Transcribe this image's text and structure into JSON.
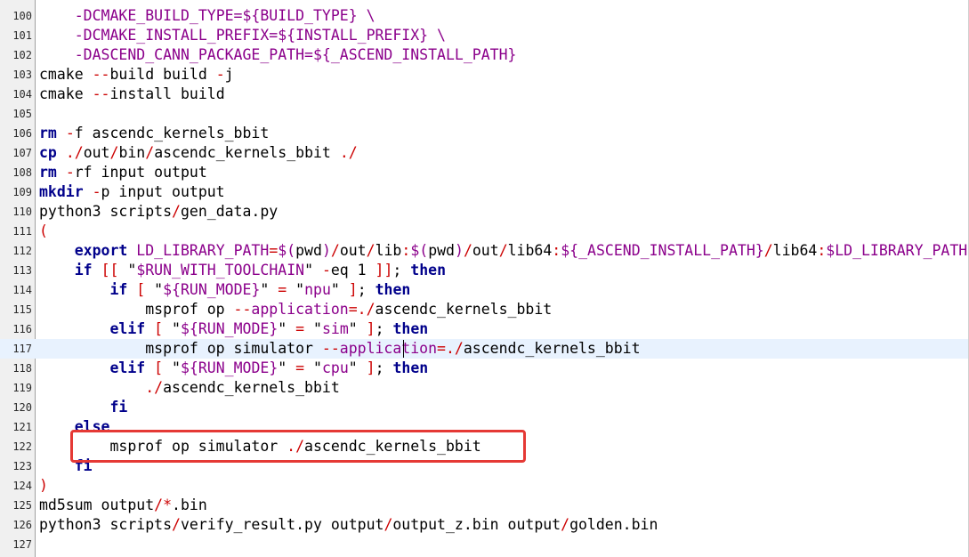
{
  "editor": {
    "lines": [
      {
        "n": "100",
        "segs": [
          [
            "    ",
            "plain"
          ],
          [
            "-DCMAKE_BUILD_TYPE=${BUILD_TYPE} \\",
            "var"
          ]
        ]
      },
      {
        "n": "101",
        "segs": [
          [
            "    ",
            "plain"
          ],
          [
            "-DCMAKE_INSTALL_PREFIX=${INSTALL_PREFIX} \\",
            "var"
          ]
        ]
      },
      {
        "n": "102",
        "segs": [
          [
            "    ",
            "plain"
          ],
          [
            "-DASCEND_CANN_PACKAGE_PATH=${_ASCEND_INSTALL_PATH}",
            "var"
          ]
        ]
      },
      {
        "n": "103",
        "segs": [
          [
            "cmake ",
            "plain"
          ],
          [
            "--",
            "op"
          ],
          [
            "build build ",
            "plain"
          ],
          [
            "-",
            "op"
          ],
          [
            "j",
            "plain"
          ]
        ]
      },
      {
        "n": "104",
        "segs": [
          [
            "cmake ",
            "plain"
          ],
          [
            "--",
            "op"
          ],
          [
            "install build",
            "plain"
          ]
        ]
      },
      {
        "n": "105",
        "segs": []
      },
      {
        "n": "106",
        "segs": [
          [
            "rm",
            "kw"
          ],
          [
            " ",
            "plain"
          ],
          [
            "-",
            "op"
          ],
          [
            "f ascendc_kernels_bbit",
            "plain"
          ]
        ]
      },
      {
        "n": "107",
        "segs": [
          [
            "cp",
            "kw"
          ],
          [
            " ",
            "plain"
          ],
          [
            "./",
            "op"
          ],
          [
            "out",
            "plain"
          ],
          [
            "/",
            "op"
          ],
          [
            "bin",
            "plain"
          ],
          [
            "/",
            "op"
          ],
          [
            "ascendc_kernels_bbit ",
            "plain"
          ],
          [
            "./",
            "op"
          ]
        ]
      },
      {
        "n": "108",
        "segs": [
          [
            "rm",
            "kw"
          ],
          [
            " ",
            "plain"
          ],
          [
            "-",
            "op"
          ],
          [
            "rf input output",
            "plain"
          ]
        ]
      },
      {
        "n": "109",
        "segs": [
          [
            "mkdir",
            "kw"
          ],
          [
            " ",
            "plain"
          ],
          [
            "-",
            "op"
          ],
          [
            "p input output",
            "plain"
          ]
        ]
      },
      {
        "n": "110",
        "segs": [
          [
            "python3 scripts",
            "plain"
          ],
          [
            "/",
            "op"
          ],
          [
            "gen_data.py",
            "plain"
          ]
        ]
      },
      {
        "n": "111",
        "segs": [
          [
            "(",
            "op"
          ]
        ]
      },
      {
        "n": "112",
        "segs": [
          [
            "    ",
            "plain"
          ],
          [
            "export",
            "kw"
          ],
          [
            " ",
            "plain"
          ],
          [
            "LD_LIBRARY_PATH",
            "var"
          ],
          [
            "=",
            "op"
          ],
          [
            "$(",
            "var"
          ],
          [
            "pwd",
            "plain"
          ],
          [
            ")",
            "var"
          ],
          [
            "/",
            "op"
          ],
          [
            "out",
            "plain"
          ],
          [
            "/",
            "op"
          ],
          [
            "lib",
            "plain"
          ],
          [
            ":",
            "op"
          ],
          [
            "$(",
            "var"
          ],
          [
            "pwd",
            "plain"
          ],
          [
            ")",
            "var"
          ],
          [
            "/",
            "op"
          ],
          [
            "out",
            "plain"
          ],
          [
            "/",
            "op"
          ],
          [
            "lib64",
            "plain"
          ],
          [
            ":",
            "op"
          ],
          [
            "${_ASCEND_INSTALL_PATH}",
            "var"
          ],
          [
            "/",
            "op"
          ],
          [
            "lib64",
            "plain"
          ],
          [
            ":",
            "op"
          ],
          [
            "$LD_LIBRARY_PATH",
            "var"
          ]
        ]
      },
      {
        "n": "113",
        "segs": [
          [
            "    ",
            "plain"
          ],
          [
            "if",
            "kw"
          ],
          [
            " ",
            "plain"
          ],
          [
            "[[",
            "op"
          ],
          [
            " \"",
            "plain"
          ],
          [
            "$RUN_WITH_TOOLCHAIN",
            "var"
          ],
          [
            "\" ",
            "plain"
          ],
          [
            "-",
            "op"
          ],
          [
            "eq 1 ",
            "plain"
          ],
          [
            "]]",
            "op"
          ],
          [
            "; ",
            "plain"
          ],
          [
            "then",
            "kw"
          ]
        ]
      },
      {
        "n": "114",
        "segs": [
          [
            "        ",
            "plain"
          ],
          [
            "if",
            "kw"
          ],
          [
            " ",
            "plain"
          ],
          [
            "[",
            "op"
          ],
          [
            " \"",
            "plain"
          ],
          [
            "${RUN_MODE}",
            "var"
          ],
          [
            "\" ",
            "plain"
          ],
          [
            "=",
            "op"
          ],
          [
            " \"",
            "plain"
          ],
          [
            "npu",
            "var"
          ],
          [
            "\" ",
            "plain"
          ],
          [
            "]",
            "op"
          ],
          [
            "; ",
            "plain"
          ],
          [
            "then",
            "kw"
          ]
        ]
      },
      {
        "n": "115",
        "segs": [
          [
            "            msprof op ",
            "plain"
          ],
          [
            "--",
            "op"
          ],
          [
            "application",
            "var"
          ],
          [
            "=./",
            "op"
          ],
          [
            "ascendc_kernels_bbit",
            "plain"
          ]
        ]
      },
      {
        "n": "116",
        "segs": [
          [
            "        ",
            "plain"
          ],
          [
            "elif",
            "kw"
          ],
          [
            " ",
            "plain"
          ],
          [
            "[",
            "op"
          ],
          [
            " \"",
            "plain"
          ],
          [
            "${RUN_MODE}",
            "var"
          ],
          [
            "\" ",
            "plain"
          ],
          [
            "=",
            "op"
          ],
          [
            " \"",
            "plain"
          ],
          [
            "sim",
            "var"
          ],
          [
            "\" ",
            "plain"
          ],
          [
            "]",
            "op"
          ],
          [
            "; ",
            "plain"
          ],
          [
            "then",
            "kw"
          ]
        ]
      },
      {
        "n": "117",
        "segs": [
          [
            "            msprof op simulator ",
            "plain"
          ],
          [
            "--",
            "op"
          ],
          [
            "application",
            "var"
          ],
          [
            "=./",
            "op"
          ],
          [
            "ascendc_kernels_bbit",
            "plain"
          ]
        ],
        "current": true
      },
      {
        "n": "118",
        "segs": [
          [
            "        ",
            "plain"
          ],
          [
            "elif",
            "kw"
          ],
          [
            " ",
            "plain"
          ],
          [
            "[",
            "op"
          ],
          [
            " \"",
            "plain"
          ],
          [
            "${RUN_MODE}",
            "var"
          ],
          [
            "\" ",
            "plain"
          ],
          [
            "=",
            "op"
          ],
          [
            " \"",
            "plain"
          ],
          [
            "cpu",
            "var"
          ],
          [
            "\" ",
            "plain"
          ],
          [
            "]",
            "op"
          ],
          [
            "; ",
            "plain"
          ],
          [
            "then",
            "kw"
          ]
        ]
      },
      {
        "n": "119",
        "segs": [
          [
            "            ",
            "plain"
          ],
          [
            "./",
            "op"
          ],
          [
            "ascendc_kernels_bbit",
            "plain"
          ]
        ]
      },
      {
        "n": "120",
        "segs": [
          [
            "        ",
            "plain"
          ],
          [
            "fi",
            "kw"
          ]
        ]
      },
      {
        "n": "121",
        "segs": [
          [
            "    ",
            "plain"
          ],
          [
            "else",
            "kw"
          ]
        ]
      },
      {
        "n": "122",
        "segs": [
          [
            "        msprof op simulator ",
            "plain"
          ],
          [
            "./",
            "op"
          ],
          [
            "ascendc_kernels_bbit",
            "plain"
          ]
        ]
      },
      {
        "n": "123",
        "segs": [
          [
            "    ",
            "plain"
          ],
          [
            "fi",
            "kw"
          ]
        ]
      },
      {
        "n": "124",
        "segs": [
          [
            ")",
            "op"
          ]
        ]
      },
      {
        "n": "125",
        "segs": [
          [
            "md5sum output",
            "plain"
          ],
          [
            "/*",
            "op"
          ],
          [
            ".bin",
            "plain"
          ]
        ]
      },
      {
        "n": "126",
        "segs": [
          [
            "python3 scripts",
            "plain"
          ],
          [
            "/",
            "op"
          ],
          [
            "verify_result.py output",
            "plain"
          ],
          [
            "/",
            "op"
          ],
          [
            "output_z.bin output",
            "plain"
          ],
          [
            "/",
            "op"
          ],
          [
            "golden.bin",
            "plain"
          ]
        ]
      },
      {
        "n": "127",
        "segs": []
      }
    ]
  },
  "colors": {
    "keyword": "#00008b",
    "variable": "#8b008b",
    "operator": "#cc0000",
    "current_line": "#e8f2fe",
    "highlight_box": "#e53935"
  }
}
